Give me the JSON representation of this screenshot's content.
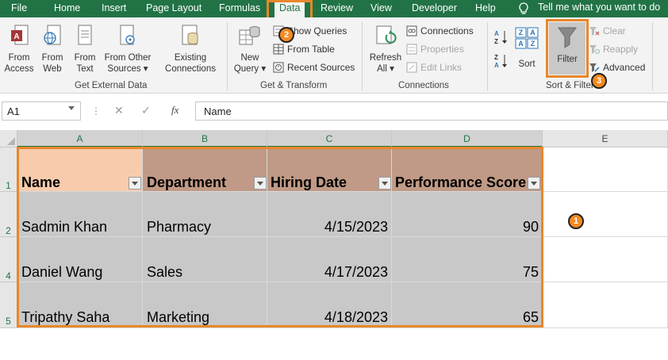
{
  "menu": {
    "tabs": [
      "File",
      "Home",
      "Insert",
      "Page Layout",
      "Formulas",
      "Data",
      "Review",
      "View",
      "Developer",
      "Help"
    ],
    "active_tab": "Data",
    "tell_me": "Tell me what you want to do"
  },
  "ribbon": {
    "get_external_data": {
      "group_label": "Get External Data",
      "from_access": [
        "From",
        "Access"
      ],
      "from_web": [
        "From",
        "Web"
      ],
      "from_text": [
        "From",
        "Text"
      ],
      "from_other_sources": [
        "From Other",
        "Sources ▾"
      ],
      "existing_connections": [
        "Existing",
        "Connections"
      ]
    },
    "get_transform": {
      "group_label": "Get & Transform",
      "new_query": [
        "New",
        "Query ▾"
      ],
      "show_queries": "Show Queries",
      "from_table": "From Table",
      "recent_sources": "Recent Sources"
    },
    "connections": {
      "group_label": "Connections",
      "refresh_all": [
        "Refresh",
        "All ▾"
      ],
      "connections": "Connections",
      "properties": "Properties",
      "edit_links": "Edit Links"
    },
    "sort_filter": {
      "group_label": "Sort & Filter",
      "sort": "Sort",
      "filter": "Filter",
      "clear": "Clear",
      "reapply": "Reapply",
      "advanced": "Advanced"
    }
  },
  "formula_bar": {
    "name_box": "A1",
    "cancel": "✕",
    "enter": "✓",
    "fx": "fx",
    "formula": "Name"
  },
  "grid": {
    "columns": [
      "A",
      "B",
      "C",
      "D",
      "E"
    ],
    "row_numbers": [
      "1",
      "2",
      "4",
      "5"
    ],
    "headers": [
      "Name",
      "Department",
      "Hiring Date",
      "Performance Score"
    ],
    "rows": [
      [
        "Sadmin Khan",
        "Pharmacy",
        "4/15/2023",
        "90"
      ],
      [
        "Daniel Wang",
        "Sales",
        "4/17/2023",
        "75"
      ],
      [
        "Tripathy Saha",
        "Marketing",
        "4/18/2023",
        "65"
      ]
    ]
  },
  "annotations": {
    "badge_1": "1",
    "badge_2": "2",
    "badge_3": "3",
    "accent_color": "#e8872a",
    "excel_green": "#217346"
  }
}
